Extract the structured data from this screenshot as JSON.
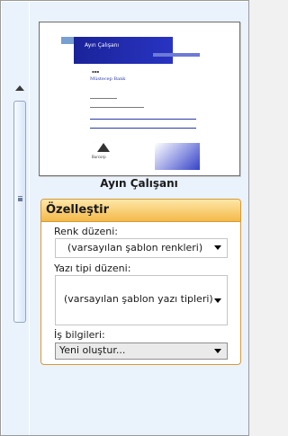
{
  "preview": {
    "caption": "Ayın Çalışanı",
    "thumbnail_title": "Ayın Çalışanı",
    "thumbnail_name": "Müstecep Bank",
    "thumbnail_logo_text": "Burcorp"
  },
  "customize_panel": {
    "title": "Özelleştir",
    "color_scheme": {
      "label": "Renk düzeni:",
      "value": "(varsayılan şablon renkleri)"
    },
    "font_scheme": {
      "label": "Yazı tipi düzeni:",
      "value": "(varsayılan şablon yazı tipleri)"
    },
    "business_info": {
      "label": "İş bilgileri:",
      "value": "Yeni oluştur..."
    }
  },
  "colors": {
    "accent": "#1a2399",
    "panel_border": "#d49b3a",
    "header_gradient_top": "#fde7a8",
    "header_gradient_bottom": "#f4b94a"
  },
  "icons": {
    "scroll_up": "triangle-up-icon",
    "dropdown": "chevron-down-icon"
  }
}
